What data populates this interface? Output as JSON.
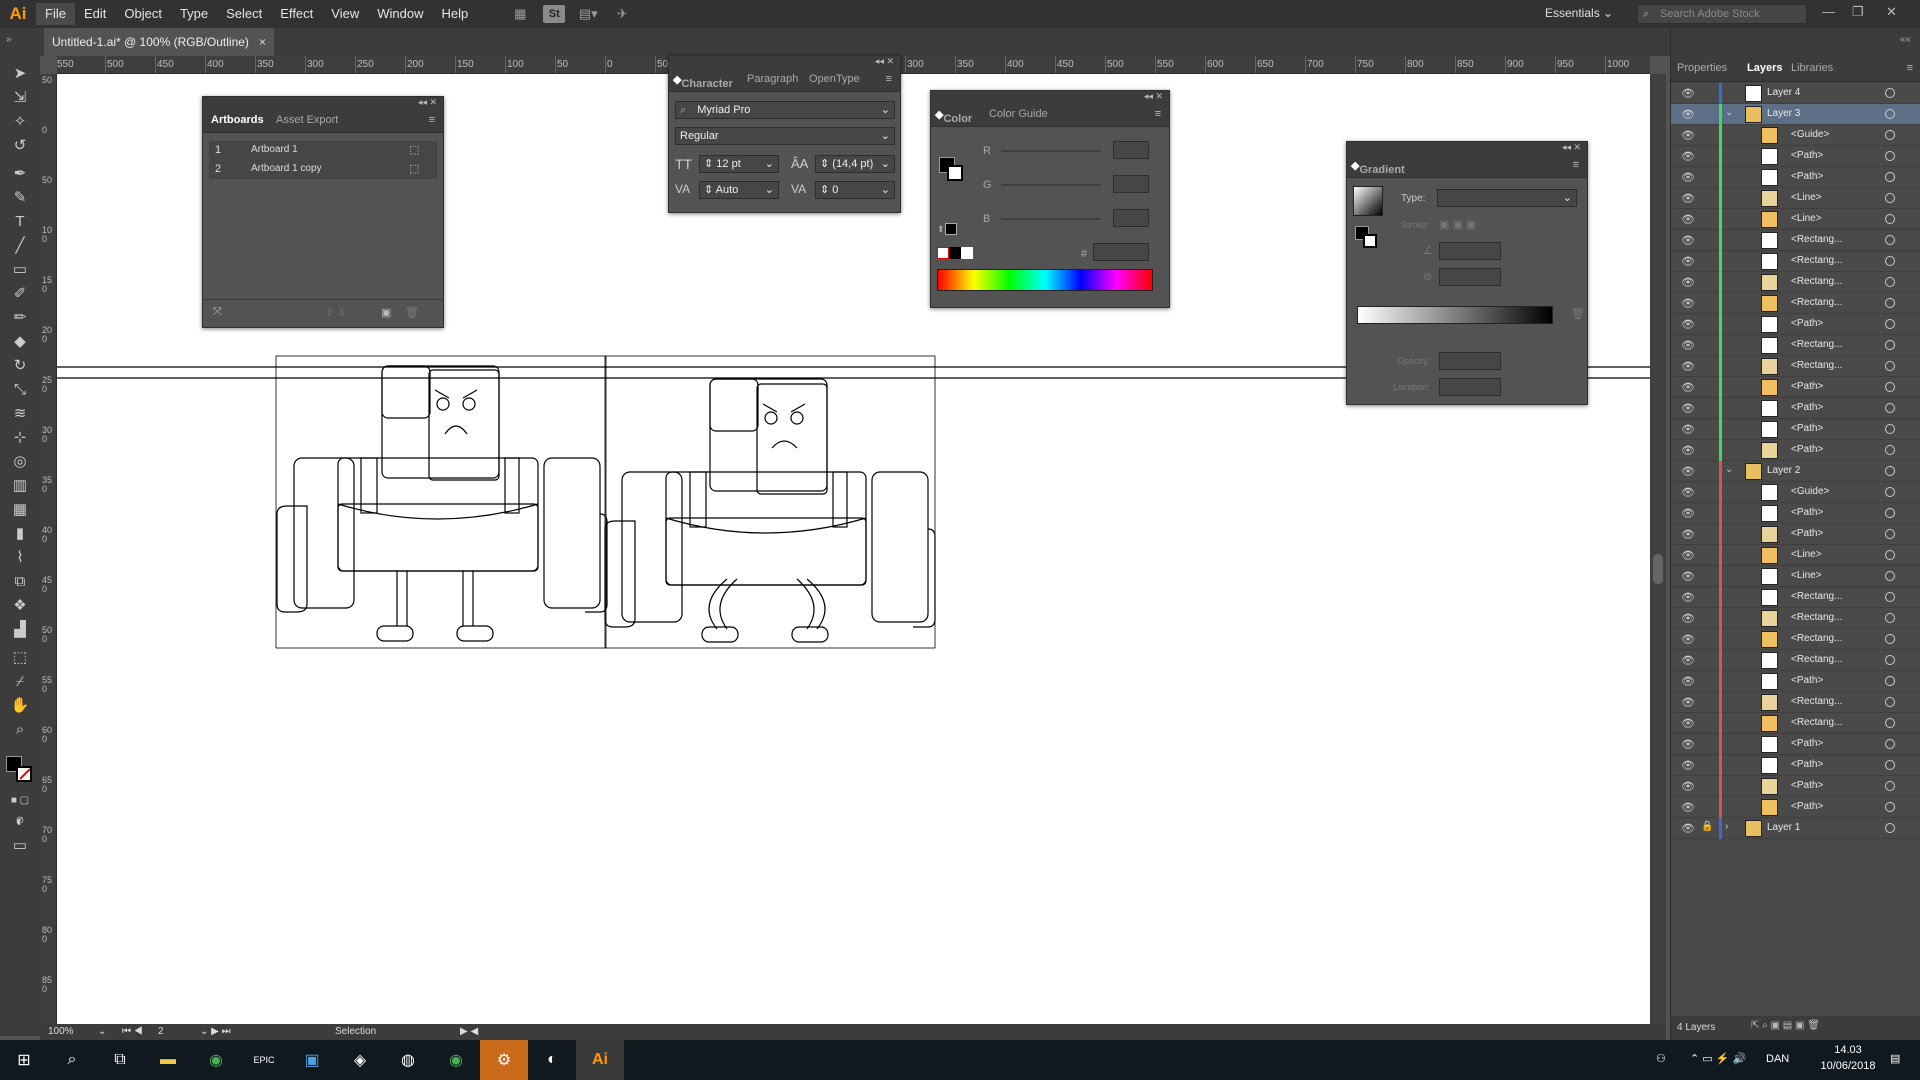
{
  "app": {
    "logo": "Ai",
    "menus": [
      "File",
      "Edit",
      "Object",
      "Type",
      "Select",
      "Effect",
      "View",
      "Window",
      "Help"
    ],
    "workspace": "Essentials",
    "search_placeholder": "Search Adobe Stock",
    "toolbar_st": "St"
  },
  "document": {
    "tab_title": "Untitled-1.ai* @ 100% (RGB/Outline)",
    "close": "×"
  },
  "rulers": {
    "h": [
      "550",
      "500",
      "450",
      "400",
      "350",
      "300",
      "250",
      "200",
      "150",
      "100",
      "50",
      "0",
      "50",
      "100",
      "150",
      "200",
      "250",
      "300",
      "350",
      "400",
      "450",
      "500",
      "550",
      "600",
      "650",
      "700",
      "750",
      "800",
      "850",
      "900",
      "950",
      "1000"
    ],
    "v": [
      "50",
      "0",
      "50",
      "100",
      "150",
      "200",
      "250",
      "300",
      "350",
      "400",
      "450",
      "500",
      "550",
      "600",
      "650",
      "700",
      "750",
      "800",
      "850",
      "900"
    ]
  },
  "status": {
    "zoom": "100%",
    "artboard_index": "2",
    "tool": "Selection"
  },
  "artboards_panel": {
    "tabs": [
      "Artboards",
      "Asset Export"
    ],
    "rows": [
      {
        "num": "1",
        "name": "Artboard 1"
      },
      {
        "num": "2",
        "name": "Artboard 1 copy"
      }
    ]
  },
  "character_panel": {
    "tabs": [
      "Character",
      "Paragraph",
      "OpenType"
    ],
    "font": "Myriad Pro",
    "style": "Regular",
    "size": "12 pt",
    "leading": "(14,4 pt)",
    "kerning": "Auto",
    "tracking": "0"
  },
  "color_panel": {
    "tabs": [
      "Color",
      "Color Guide"
    ],
    "labels": [
      "R",
      "G",
      "B"
    ],
    "hash": "#"
  },
  "gradient_panel": {
    "title": "Gradient",
    "type_label": "Type:",
    "stroke_label": "Stroke:",
    "opacity_label": "Opacity:",
    "location_label": "Location:"
  },
  "right_panel": {
    "tabs": [
      "Properties",
      "Layers",
      "Libraries"
    ],
    "footer": "4 Layers",
    "layers": [
      {
        "name": "Layer 4",
        "level": 0,
        "color": "#3a6bd8",
        "selected": false,
        "expand": ""
      },
      {
        "name": "Layer 3",
        "level": 0,
        "color": "#3ddc62",
        "selected": true,
        "expand": "v"
      },
      {
        "name": "<Guide>",
        "level": 1,
        "color": "#3ddc62",
        "selected": false,
        "expand": ""
      },
      {
        "name": "<Path>",
        "level": 1,
        "color": "#3ddc62",
        "selected": false,
        "expand": ""
      },
      {
        "name": "<Path>",
        "level": 1,
        "color": "#3ddc62",
        "selected": false,
        "expand": ""
      },
      {
        "name": "<Line>",
        "level": 1,
        "color": "#3ddc62",
        "selected": false,
        "expand": ""
      },
      {
        "name": "<Line>",
        "level": 1,
        "color": "#3ddc62",
        "selected": false,
        "expand": ""
      },
      {
        "name": "<Rectang...",
        "level": 1,
        "color": "#3ddc62",
        "selected": false,
        "expand": ""
      },
      {
        "name": "<Rectang...",
        "level": 1,
        "color": "#3ddc62",
        "selected": false,
        "expand": ""
      },
      {
        "name": "<Rectang...",
        "level": 1,
        "color": "#3ddc62",
        "selected": false,
        "expand": ""
      },
      {
        "name": "<Rectang...",
        "level": 1,
        "color": "#3ddc62",
        "selected": false,
        "expand": ""
      },
      {
        "name": "<Path>",
        "level": 1,
        "color": "#3ddc62",
        "selected": false,
        "expand": ""
      },
      {
        "name": "<Rectang...",
        "level": 1,
        "color": "#3ddc62",
        "selected": false,
        "expand": ""
      },
      {
        "name": "<Rectang...",
        "level": 1,
        "color": "#3ddc62",
        "selected": false,
        "expand": ""
      },
      {
        "name": "<Path>",
        "level": 1,
        "color": "#3ddc62",
        "selected": false,
        "expand": ""
      },
      {
        "name": "<Path>",
        "level": 1,
        "color": "#3ddc62",
        "selected": false,
        "expand": ""
      },
      {
        "name": "<Path>",
        "level": 1,
        "color": "#3ddc62",
        "selected": false,
        "expand": ""
      },
      {
        "name": "<Path>",
        "level": 1,
        "color": "#3ddc62",
        "selected": false,
        "expand": ""
      },
      {
        "name": "Layer 2",
        "level": 0,
        "color": "#e05050",
        "selected": false,
        "expand": "v"
      },
      {
        "name": "<Guide>",
        "level": 1,
        "color": "#e05050",
        "selected": false,
        "expand": ""
      },
      {
        "name": "<Path>",
        "level": 1,
        "color": "#e05050",
        "selected": false,
        "expand": ""
      },
      {
        "name": "<Path>",
        "level": 1,
        "color": "#e05050",
        "selected": false,
        "expand": ""
      },
      {
        "name": "<Line>",
        "level": 1,
        "color": "#e05050",
        "selected": false,
        "expand": ""
      },
      {
        "name": "<Line>",
        "level": 1,
        "color": "#e05050",
        "selected": false,
        "expand": ""
      },
      {
        "name": "<Rectang...",
        "level": 1,
        "color": "#e05050",
        "selected": false,
        "expand": ""
      },
      {
        "name": "<Rectang...",
        "level": 1,
        "color": "#e05050",
        "selected": false,
        "expand": ""
      },
      {
        "name": "<Rectang...",
        "level": 1,
        "color": "#e05050",
        "selected": false,
        "expand": ""
      },
      {
        "name": "<Rectang...",
        "level": 1,
        "color": "#e05050",
        "selected": false,
        "expand": ""
      },
      {
        "name": "<Path>",
        "level": 1,
        "color": "#e05050",
        "selected": false,
        "expand": ""
      },
      {
        "name": "<Rectang...",
        "level": 1,
        "color": "#e05050",
        "selected": false,
        "expand": ""
      },
      {
        "name": "<Rectang...",
        "level": 1,
        "color": "#e05050",
        "selected": false,
        "expand": ""
      },
      {
        "name": "<Path>",
        "level": 1,
        "color": "#e05050",
        "selected": false,
        "expand": ""
      },
      {
        "name": "<Path>",
        "level": 1,
        "color": "#e05050",
        "selected": false,
        "expand": ""
      },
      {
        "name": "<Path>",
        "level": 1,
        "color": "#e05050",
        "selected": false,
        "expand": ""
      },
      {
        "name": "<Path>",
        "level": 1,
        "color": "#e05050",
        "selected": false,
        "expand": ""
      },
      {
        "name": "Layer 1",
        "level": 0,
        "color": "#3a6bd8",
        "selected": false,
        "expand": ">",
        "locked": true
      }
    ]
  },
  "taskbar": {
    "language": "DAN",
    "time": "14.03",
    "date": "10/06/2018",
    "epic_label": "EPIC"
  },
  "colors": {
    "accent_orange": "#ff9a00",
    "selection_blue": "#5d6f86"
  }
}
